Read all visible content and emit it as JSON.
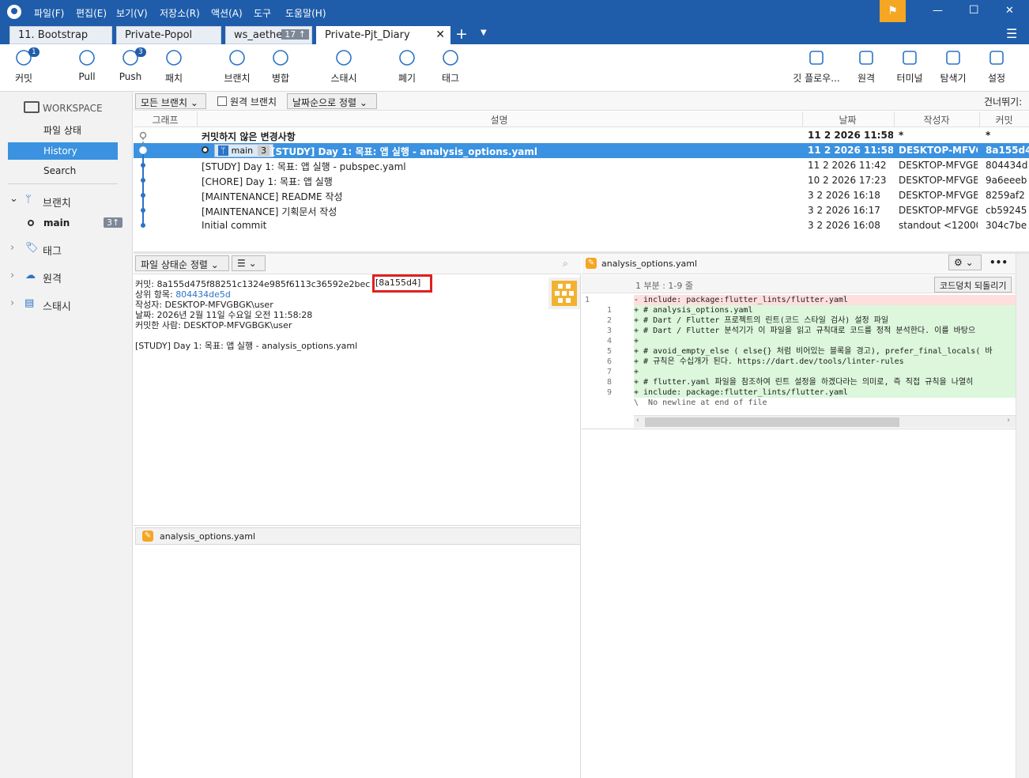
{
  "menu": {
    "items": [
      "파일(F)",
      "편집(E)",
      "보기(V)",
      "저장소(R)",
      "액션(A)",
      "도구",
      "도움말(H)"
    ],
    "window_controls": [
      "—",
      "☐",
      "✕"
    ]
  },
  "tabs": [
    {
      "label": "11. Bootstrap"
    },
    {
      "label": "Private-Popol"
    },
    {
      "label": "ws_aether",
      "badge": "17 ↑"
    },
    {
      "label": "Private-Pjt_Diary",
      "active": true
    }
  ],
  "toolbar": {
    "left": [
      {
        "label": "커밋",
        "badge": "1",
        "icon": "commit-icon"
      },
      {
        "label": "Pull",
        "icon": "pull-icon"
      },
      {
        "label": "Push",
        "badge": "3",
        "icon": "push-icon"
      },
      {
        "label": "패치",
        "icon": "patch-icon"
      },
      {
        "label": "브랜치",
        "icon": "branch-icon"
      },
      {
        "label": "병합",
        "icon": "merge-icon"
      },
      {
        "label": "스태시",
        "icon": "stash-icon"
      },
      {
        "label": "폐기",
        "icon": "discard-icon"
      },
      {
        "label": "태그",
        "icon": "tag-icon"
      }
    ],
    "right": [
      {
        "label": "깃 플로우...",
        "icon": "gitflow-icon"
      },
      {
        "label": "원격",
        "icon": "globe-icon"
      },
      {
        "label": "터미널",
        "icon": "terminal-icon"
      },
      {
        "label": "탐색기",
        "icon": "explorer-icon"
      },
      {
        "label": "설정",
        "icon": "settings-icon"
      }
    ]
  },
  "sidebar": {
    "workspace": "WORKSPACE",
    "items": [
      "파일 상태",
      "History",
      "Search"
    ],
    "branches": "브랜치",
    "branch_main": "main",
    "branch_badge": "3↑",
    "tags": "태그",
    "remotes": "원격",
    "stashes": "스태시"
  },
  "filter": {
    "all_branches": "모든 브랜치",
    "remote_branches": "원격 브랜치",
    "sort": "날짜순으로 정렬",
    "skip": "건너뛰기:"
  },
  "columns": {
    "graph": "그래프",
    "desc": "설명",
    "date": "날짜",
    "author": "작성자",
    "commit": "커밋"
  },
  "commits": [
    {
      "desc": "커밋하지 않은 변경사항",
      "date": "11 2 2026 11:58",
      "author": "*",
      "hash": "*",
      "bold": true
    },
    {
      "desc": "[STUDY] Day 1: 목표: 앱 실행 - analysis_options.yaml",
      "date": "11 2 2026 11:58",
      "author": "DESKTOP-MFVGE",
      "hash": "8a155d4",
      "selected": true,
      "branch": "main",
      "ahead": "3"
    },
    {
      "desc": "[STUDY] Day 1: 목표: 앱 실행 - pubspec.yaml",
      "date": "11 2 2026 11:42",
      "author": "DESKTOP-MFVGBK",
      "hash": "804434d"
    },
    {
      "desc": "[CHORE] Day 1: 목표: 앱 실행",
      "date": "10 2 2026 17:23",
      "author": "DESKTOP-MFVGBK",
      "hash": "9a6eeeb"
    },
    {
      "desc": "[MAINTENANCE] README 작성",
      "date": "3 2 2026 16:18",
      "author": "DESKTOP-MFVGBK",
      "hash": "8259af2"
    },
    {
      "desc": "[MAINTENANCE] 기획문서 작성",
      "date": "3 2 2026 16:17",
      "author": "DESKTOP-MFVGBK",
      "hash": "cb59245"
    },
    {
      "desc": "Initial commit",
      "date": "3 2 2026 16:08",
      "author": "standout <120000",
      "hash": "304c7be"
    }
  ],
  "detail": {
    "sort_label": "파일 상태순 정렬",
    "commit_line": "커밋: 8a155d475f88251c1324e985f6113c36592e2bec",
    "commit_short": "[8a155d4]",
    "parent_label": "상위 항목:",
    "parent_hash": "804434de5d",
    "author_line": "작성자: DESKTOP-MFVGBGK\\user",
    "date_line": "날짜: 2026년 2월 11일 수요일 오전 11:58:28",
    "committer_line": "커밋한 사람: DESKTOP-MFVGBGK\\user",
    "message": "[STUDY] Day 1: 목표: 앱 실행 - analysis_options.yaml",
    "file": "analysis_options.yaml"
  },
  "diff": {
    "file": "analysis_options.yaml",
    "hunk": "1 부분 : 1-9 줄",
    "revert": "코드덩치 되돌리기",
    "lines": [
      {
        "old": "1",
        "new": "",
        "type": "del",
        "text": "- include: package:flutter_lints/flutter.yaml"
      },
      {
        "old": "",
        "new": "1",
        "type": "add",
        "text": "+ # analysis_options.yaml"
      },
      {
        "old": "",
        "new": "2",
        "type": "add",
        "text": "+ # Dart / Flutter 프로젝트의 린트(코드 스타일 검사) 설정 파일"
      },
      {
        "old": "",
        "new": "3",
        "type": "add",
        "text": "+ # Dart / Flutter 분석기가 이 파일을 읽고 규칙대로 코드를 정적 분석한다. 이를 바탕으"
      },
      {
        "old": "",
        "new": "4",
        "type": "add",
        "text": "+"
      },
      {
        "old": "",
        "new": "5",
        "type": "add",
        "text": "+ # avoid_empty_else ( else{} 처럼 비어있는 블록을 경고), prefer_final_locals( 바"
      },
      {
        "old": "",
        "new": "6",
        "type": "add",
        "text": "+ # 규칙은 수십개가 된다. https://dart.dev/tools/linter-rules"
      },
      {
        "old": "",
        "new": "7",
        "type": "add",
        "text": "+"
      },
      {
        "old": "",
        "new": "8",
        "type": "add",
        "text": "+ # flutter.yaml 파일을 참조하여 린트 설정을 하겠다라는 의미로, 즉 직접 규칙을 나열히"
      },
      {
        "old": "",
        "new": "9",
        "type": "add",
        "text": "+ include: package:flutter_lints/flutter.yaml"
      },
      {
        "old": "",
        "new": "",
        "type": "meta",
        "text": "\\  No newline at end of file"
      }
    ]
  }
}
